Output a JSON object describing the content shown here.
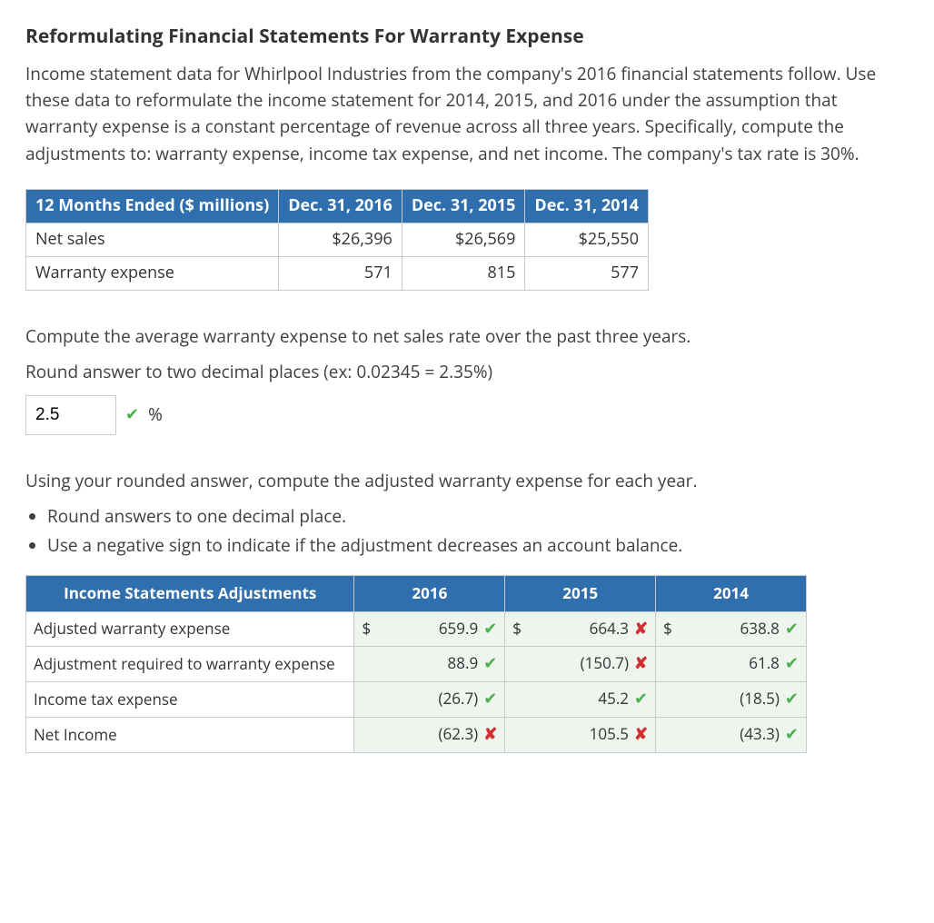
{
  "title": "Reformulating Financial Statements For Warranty Expense",
  "intro": "Income statement data for Whirlpool Industries from the company's 2016 financial statements follow. Use these data to reformulate the income statement for 2014, 2015, and 2016 under the assumption that warranty expense is a constant percentage of revenue across all three years. Specifically, compute the adjustments to: warranty expense, income tax expense, and net income. The company's tax rate is 30%.",
  "table1": {
    "header": [
      "12 Months Ended ($ millions)",
      "Dec. 31, 2016",
      "Dec. 31, 2015",
      "Dec. 31, 2014"
    ],
    "rows": [
      {
        "label": "Net sales",
        "c2016": "$26,396",
        "c2015": "$26,569",
        "c2014": "$25,550"
      },
      {
        "label": "Warranty expense",
        "c2016": "571",
        "c2015": "815",
        "c2014": "577"
      }
    ]
  },
  "q1": "Compute the average warranty expense to net sales rate over the past three years.",
  "q1_hint": "Round answer to two decimal places (ex: 0.02345 = 2.35%)",
  "q1_value": "2.5",
  "q1_mark": "check",
  "pct_symbol": "%",
  "q2": "Using your rounded answer, compute the adjusted warranty expense for each year.",
  "bullets": [
    "Round answers to one decimal place.",
    "Use a negative sign to indicate if the adjustment decreases an account balance."
  ],
  "table2": {
    "header": [
      "Income Statements Adjustments",
      "2016",
      "2015",
      "2014"
    ],
    "rows": [
      {
        "label": "Adjusted warranty expense",
        "c2016": {
          "prefix": "$",
          "value": "659.9",
          "mark": "check"
        },
        "c2015": {
          "prefix": "$",
          "value": "664.3",
          "mark": "cross"
        },
        "c2014": {
          "prefix": "$",
          "value": "638.8",
          "mark": "check"
        }
      },
      {
        "label": "Adjustment required to warranty expense",
        "c2016": {
          "prefix": "",
          "value": "88.9",
          "mark": "check"
        },
        "c2015": {
          "prefix": "",
          "value": "(150.7)",
          "mark": "cross"
        },
        "c2014": {
          "prefix": "",
          "value": "61.8",
          "mark": "check"
        }
      },
      {
        "label": "Income tax expense",
        "c2016": {
          "prefix": "",
          "value": "(26.7)",
          "mark": "check"
        },
        "c2015": {
          "prefix": "",
          "value": "45.2",
          "mark": "check"
        },
        "c2014": {
          "prefix": "",
          "value": "(18.5)",
          "mark": "check"
        }
      },
      {
        "label": "Net Income",
        "c2016": {
          "prefix": "",
          "value": "(62.3)",
          "mark": "cross"
        },
        "c2015": {
          "prefix": "",
          "value": "105.5",
          "mark": "cross"
        },
        "c2014": {
          "prefix": "",
          "value": "(43.3)",
          "mark": "check"
        }
      }
    ]
  },
  "marks": {
    "check": "✔",
    "cross": "✘"
  }
}
